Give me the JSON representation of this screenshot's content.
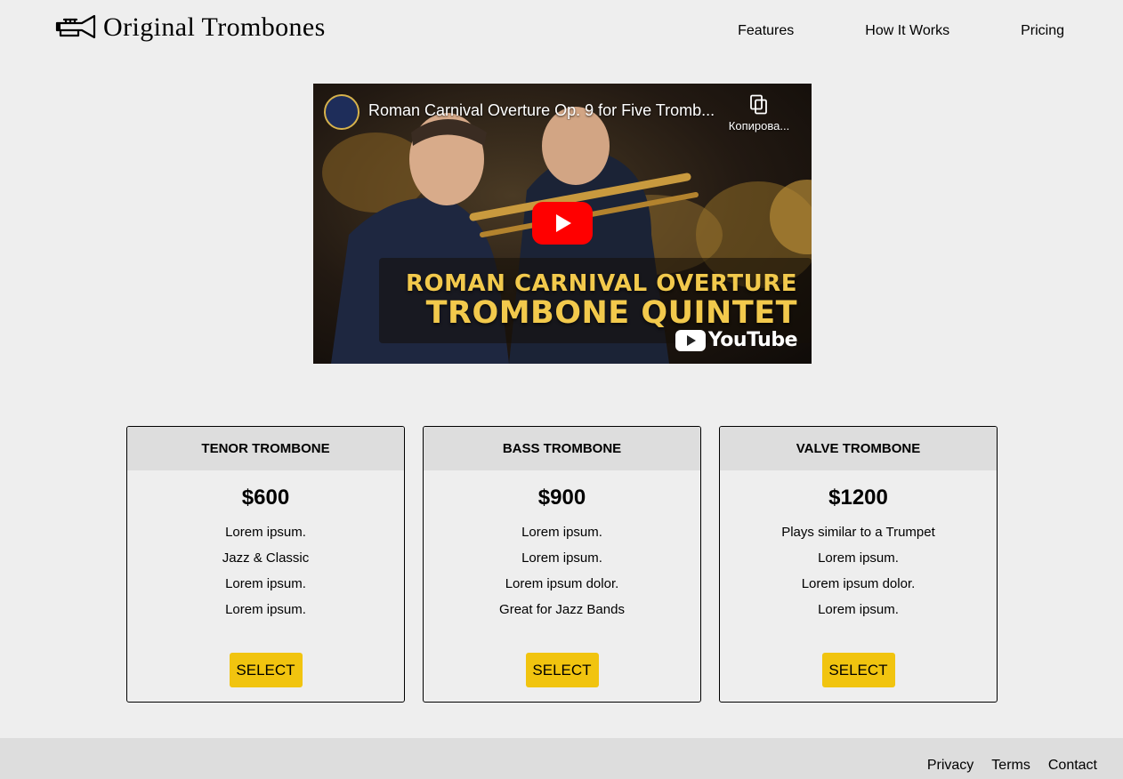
{
  "header": {
    "brand": "Original Trombones",
    "logo_icon": "trumpet-icon",
    "nav": [
      {
        "label": "Features"
      },
      {
        "label": "How It Works"
      },
      {
        "label": "Pricing"
      }
    ]
  },
  "video": {
    "title": "Roman Carnival Overture Op. 9 for Five Tromb...",
    "copy_label": "Копирова...",
    "banner_line1": "ROMAN CARNIVAL OVERTURE",
    "banner_line2": "TROMBONE QUINTET",
    "brand_label": "YouTube",
    "play_color": "#ff0000",
    "banner_color": "#f2c94c"
  },
  "plans": [
    {
      "name": "TENOR TROMBONE",
      "price": "$600",
      "features": [
        "Lorem ipsum.",
        "Jazz & Classic",
        "Lorem ipsum.",
        "Lorem ipsum."
      ],
      "button": "SELECT"
    },
    {
      "name": "BASS TROMBONE",
      "price": "$900",
      "features": [
        "Lorem ipsum.",
        "Lorem ipsum.",
        "Lorem ipsum dolor.",
        "Great for Jazz Bands"
      ],
      "button": "SELECT"
    },
    {
      "name": "VALVE TROMBONE",
      "price": "$1200",
      "features": [
        "Plays similar to a Trumpet",
        "Lorem ipsum.",
        "Lorem ipsum dolor.",
        "Lorem ipsum."
      ],
      "button": "SELECT"
    }
  ],
  "footer": {
    "links": [
      {
        "label": "Privacy"
      },
      {
        "label": "Terms"
      },
      {
        "label": "Contact"
      }
    ]
  },
  "colors": {
    "background": "#eeeeee",
    "card_header": "#dddddd",
    "button": "#f1c40f",
    "footer": "#dddddd"
  }
}
